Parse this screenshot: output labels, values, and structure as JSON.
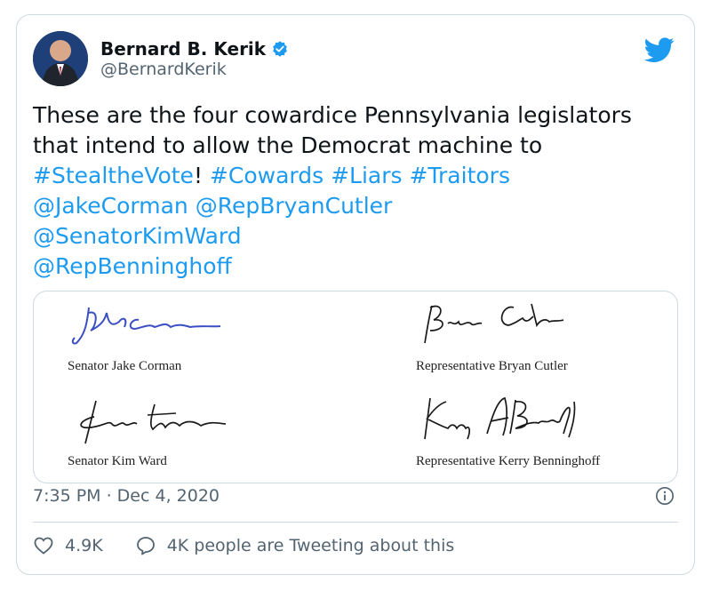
{
  "author": {
    "name": "Bernard B. Kerik",
    "handle": "@BernardKerik"
  },
  "tweet": {
    "line1": "These are the four cowardice Pennsylvania legislators",
    "line2": "that intend to allow the Democrat machine to",
    "hashtag_steal": "#StealtheVote",
    "bang": "!",
    "hashtag_cowards": "#Cowards",
    "hashtag_liars": "#Liars",
    "hashtag_traitors": "#Traitors",
    "mention_corman": "@JakeCorman",
    "mention_cutler": "@RepBryanCutler",
    "mention_ward": "@SenatorKimWard",
    "mention_benninghoff": "@RepBenninghoff"
  },
  "media": {
    "captions": [
      "Senator Jake Corman",
      "Representative Bryan Cutler",
      "Senator Kim Ward",
      "Representative Kerry Benninghoff"
    ],
    "signatures": [
      "Jake Corman",
      "Bryan Cutler",
      "Kim Ward",
      "Kerry A. Benninghoff"
    ]
  },
  "timestamp": "7:35 PM · Dec 4, 2020",
  "stats": {
    "likes": "4.9K",
    "tweeting": "4K people are Tweeting about this"
  },
  "colors": {
    "link": "#1d9bf0",
    "muted": "#536471",
    "border": "#cfd9de",
    "verified": "#1d9bf0"
  },
  "icons": [
    "verified-badge-icon",
    "twitter-bird-icon",
    "info-icon",
    "heart-icon",
    "speech-bubble-icon"
  ]
}
